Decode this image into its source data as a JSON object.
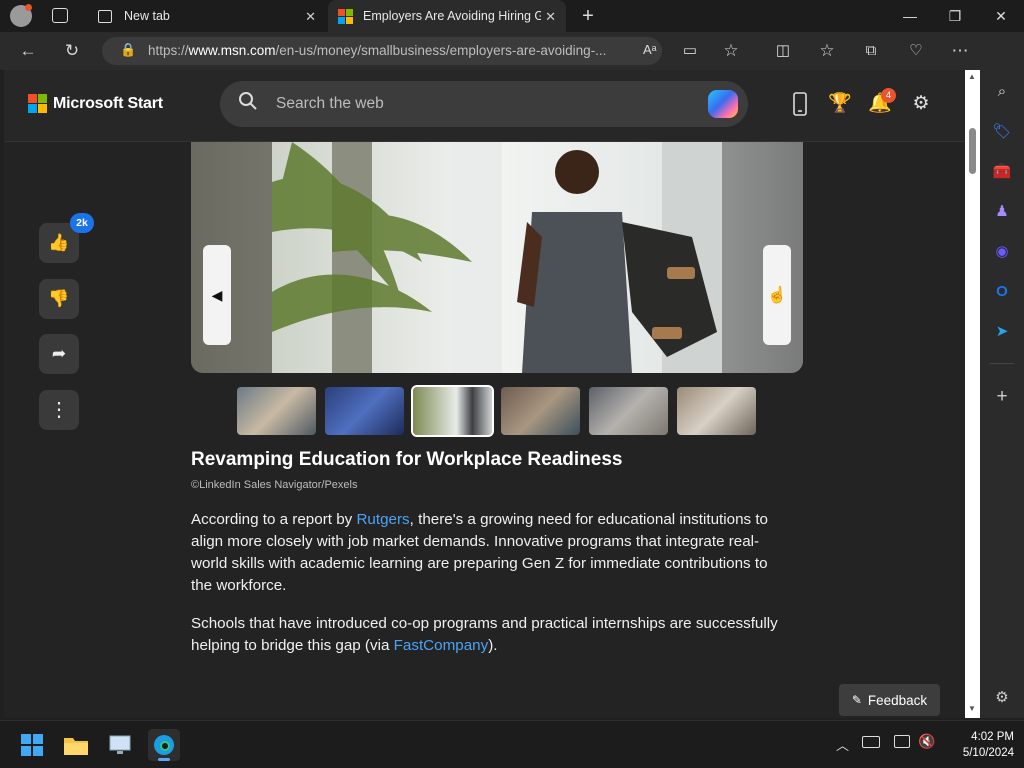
{
  "browser": {
    "tabs": [
      {
        "label": "New tab",
        "icon": "new-tab-icon"
      },
      {
        "label": "Employers Are Avoiding Hiring G",
        "icon": "microsoft-logo-icon"
      }
    ],
    "url_prefix": "https://",
    "url_host": "www.msn.com",
    "url_path": "/en-us/money/smallbusiness/employers-are-avoiding-..."
  },
  "header": {
    "brand": "Microsoft Start",
    "search_placeholder": "Search the web",
    "notifications_count": "4"
  },
  "actions": {
    "like_count": "2k"
  },
  "article": {
    "slide_title": "Revamping Education for Workplace Readiness",
    "credit": "©LinkedIn Sales Navigator/Pexels",
    "p1_before": "According to a report by ",
    "p1_link": "Rutgers",
    "p1_after": ", there's a growing need for educational institutions to align more closely with job market demands. Innovative programs that integrate real-world skills with academic learning are preparing Gen Z for immediate contributions to the workforce.",
    "p2_before": "Schools that have introduced co-op programs and practical internships are successfully helping to bridge this gap (via ",
    "p2_link": "FastCompany",
    "p2_after": ")."
  },
  "feedback_label": "Feedback",
  "taskbar": {
    "time": "4:02 PM",
    "date": "5/10/2024"
  },
  "colors": {
    "accent": "#1a73e8",
    "link": "#4ca3f5",
    "badge": "#e8552d"
  }
}
